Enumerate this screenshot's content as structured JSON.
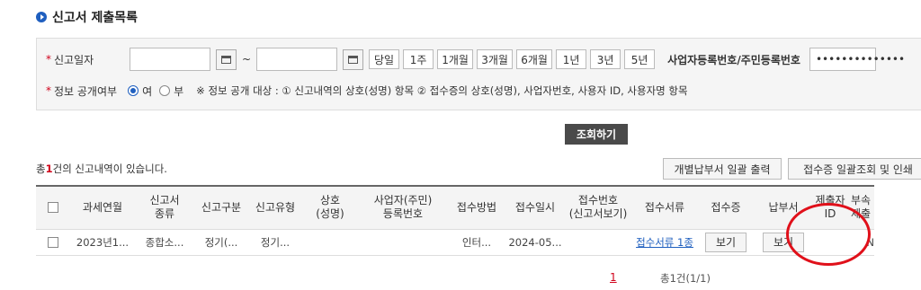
{
  "page": {
    "title": "신고서 제출목록"
  },
  "search": {
    "date_label": "신고일자",
    "date_sep": "~",
    "period_buttons": [
      "당일",
      "1주",
      "1개월",
      "3개월",
      "6개월",
      "1년",
      "3년",
      "5년"
    ],
    "bizno_label": "사업자등록번호/주민등록번호",
    "bizno_value": "••••••••••••••",
    "public_label": "정보 공개여부",
    "radio_yes": "여",
    "radio_no": "부",
    "notice": "※ 정보 공개 대상 : ① 신고내역의 상호(성명) 항목 ② 접수증의 상호(성명), 사업자번호, 사용자 ID, 사용자명 항목",
    "query_button": "조회하기"
  },
  "result": {
    "count_prefix": "총",
    "count_num": "1",
    "count_suffix": "건의 신고내역이 있습니다.",
    "bulk_print_button": "개별납부서 일괄 출력",
    "receipt_print_button": "접수증 일괄조회 및 인쇄"
  },
  "table": {
    "headers": [
      "과세연월",
      "신고서\n종류",
      "신고구분",
      "신고유형",
      "상호\n(성명)",
      "사업자(주민)\n등록번호",
      "접수방법",
      "접수일시",
      "접수번호\n(신고서보기)",
      "접수서류",
      "접수증",
      "납부서",
      "제출자\nID",
      "부속\n제출"
    ],
    "row": {
      "period": "2023년1...",
      "kind": "종합소...",
      "division": "정기(...",
      "type": "정기...",
      "name": "",
      "regno": "",
      "method": "인터...",
      "datetime": "2024-05...",
      "receipt_no": "",
      "docs": "접수서류 1종",
      "receipt_btn": "보기",
      "payment_btn": "보기",
      "submitter": "",
      "attach": "N"
    }
  },
  "pager": {
    "current": "1",
    "total": "총1건(1/1)"
  },
  "colors": {
    "accent": "#1f5fbf",
    "required": "#d0021b",
    "highlight_circle": "#e0101a"
  }
}
